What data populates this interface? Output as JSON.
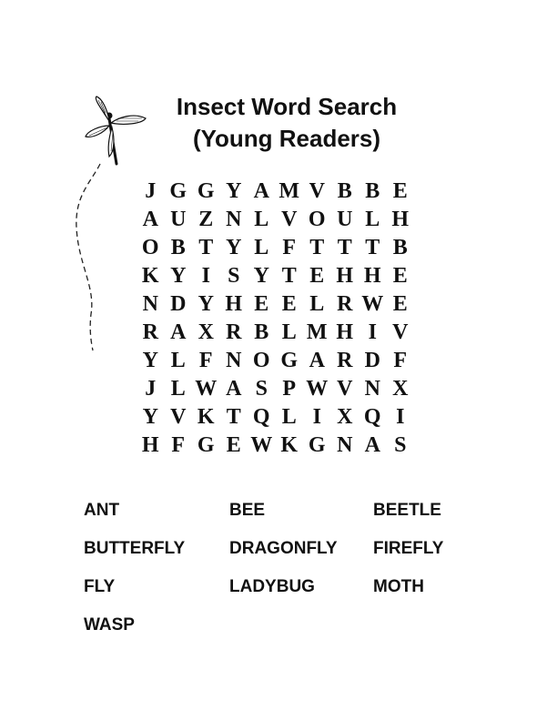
{
  "title": {
    "line1": "Insect Word Search",
    "line2": "(Young Readers)"
  },
  "illustration": {
    "icon": "dragonfly-icon"
  },
  "puzzle": {
    "rows": [
      [
        "J",
        "G",
        "G",
        "Y",
        "A",
        "M",
        "V",
        "B",
        "B",
        "E"
      ],
      [
        "A",
        "U",
        "Z",
        "N",
        "L",
        "V",
        "O",
        "U",
        "L",
        "H"
      ],
      [
        "O",
        "B",
        "T",
        "Y",
        "L",
        "F",
        "T",
        "T",
        "T",
        "B"
      ],
      [
        "K",
        "Y",
        "I",
        "S",
        "Y",
        "T",
        "E",
        "H",
        "H",
        "E"
      ],
      [
        "N",
        "D",
        "Y",
        "H",
        "E",
        "E",
        "L",
        "R",
        "W",
        "E"
      ],
      [
        "R",
        "A",
        "X",
        "R",
        "B",
        "L",
        "M",
        "H",
        "I",
        "V"
      ],
      [
        "Y",
        "L",
        "F",
        "N",
        "O",
        "G",
        "A",
        "R",
        "D",
        "F"
      ],
      [
        "J",
        "L",
        "W",
        "A",
        "S",
        "P",
        "W",
        "V",
        "N",
        "X"
      ],
      [
        "Y",
        "V",
        "K",
        "T",
        "Q",
        "L",
        "I",
        "X",
        "Q",
        "I"
      ],
      [
        "H",
        "F",
        "G",
        "E",
        "W",
        "K",
        "G",
        "N",
        "A",
        "S"
      ]
    ]
  },
  "word_list": [
    "ANT",
    "BEE",
    "BEETLE",
    "BUTTERFLY",
    "DRAGONFLY",
    "FIREFLY",
    "FLY",
    "LADYBUG",
    "MOTH",
    "WASP"
  ]
}
